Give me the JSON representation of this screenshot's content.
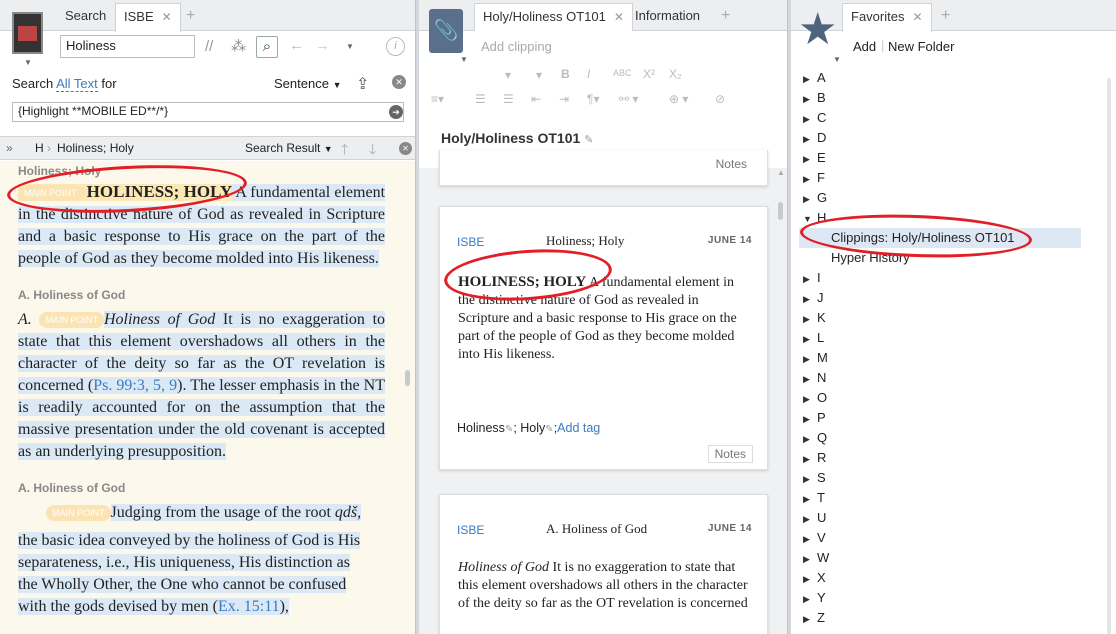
{
  "left": {
    "tabs": [
      "Search",
      "ISBE"
    ],
    "search_value": "Holiness",
    "search_label": "Search",
    "search_scope": "All Text",
    "search_for": "for",
    "sentence": "Sentence",
    "query": "{Highlight **MOBILE ED**/*}",
    "crumb_letter": "H",
    "crumb_sep": "›",
    "crumb": "Holiness; Holy",
    "search_result": "Search Result",
    "reader": {
      "cut_heading": "Holiness; Holy",
      "main_point": "MAIN POINT",
      "p1_title": "HOLINESS; HOLY",
      "p1_text": " A fundamental element in the distinctive nature of God as revealed in Scripture and a basic response to His grace on the part of the people of God as they become molded into His likeness.",
      "h2": "A. Holiness of God",
      "p2_label": "A.",
      "p2_italic": "Holiness of God",
      "p2_text": " It is no exaggeration to state that this element overshadows all others in the character of the deity so far as the OT revelation is concerned (",
      "p2_ref": "Ps. 99:3, 5, 9",
      "p2_text2": "). The lesser emphasis in the NT is readily accounted for on the assumption that the massive presentation under the old covenant is accepted as an underlying presupposition.",
      "h3": "A. Holiness of God",
      "p3_text": "Judging from the usage of the root ",
      "p3_italic": "qdš,",
      "p3_text2": "the basic idea conveyed by the holiness of God is His separateness, i.e., His uniqueness, His distinction as the Wholly Other, the One who cannot be confused with the gods devised by men (",
      "p3_ref": "Ex. 15:11",
      "p3_text3": "),"
    }
  },
  "middle": {
    "tabs": [
      "Holy/Holiness OT101",
      "Information"
    ],
    "add_clipping": "Add clipping",
    "title": "Holy/Holiness OT101",
    "notes": "Notes",
    "card1": {
      "source": "ISBE",
      "heading": "Holiness; Holy",
      "date": "JUNE 14",
      "bold": "HOLINESS; HOLY",
      "text": " A fundamental element in the distinctive nature of God as revealed in Scripture and a basic response to His grace on the part of the people of God as they become molded into His likeness.",
      "tag1": "Holiness",
      "tag2": "Holy",
      "add_tag": "Add tag"
    },
    "card2": {
      "source": "ISBE",
      "heading": "A. Holiness of God",
      "date": "JUNE 14",
      "italic": "Holiness of God",
      "text": " It is no exaggeration to state that this element overshadows all others in the character of the deity so far as the OT revelation is concerned"
    }
  },
  "right": {
    "tabs": [
      "Favorites"
    ],
    "add": "Add",
    "new_folder": "New Folder",
    "letters_top": [
      "A",
      "B",
      "C",
      "D",
      "E",
      "F",
      "G",
      "H"
    ],
    "h_children": [
      "Clippings: Holy/Holiness OT101",
      "Hyper History"
    ],
    "letters_bottom": [
      "I",
      "J",
      "K",
      "L",
      "M",
      "N",
      "O",
      "P",
      "Q",
      "R",
      "S",
      "T",
      "U",
      "V",
      "W",
      "X",
      "Y",
      "Z"
    ]
  },
  "colors": {
    "accent": "#3a7bbf",
    "annotation": "#e21e26",
    "highlight_blue": "#dbe9f6",
    "highlight_yellow": "#fbe8b5"
  }
}
